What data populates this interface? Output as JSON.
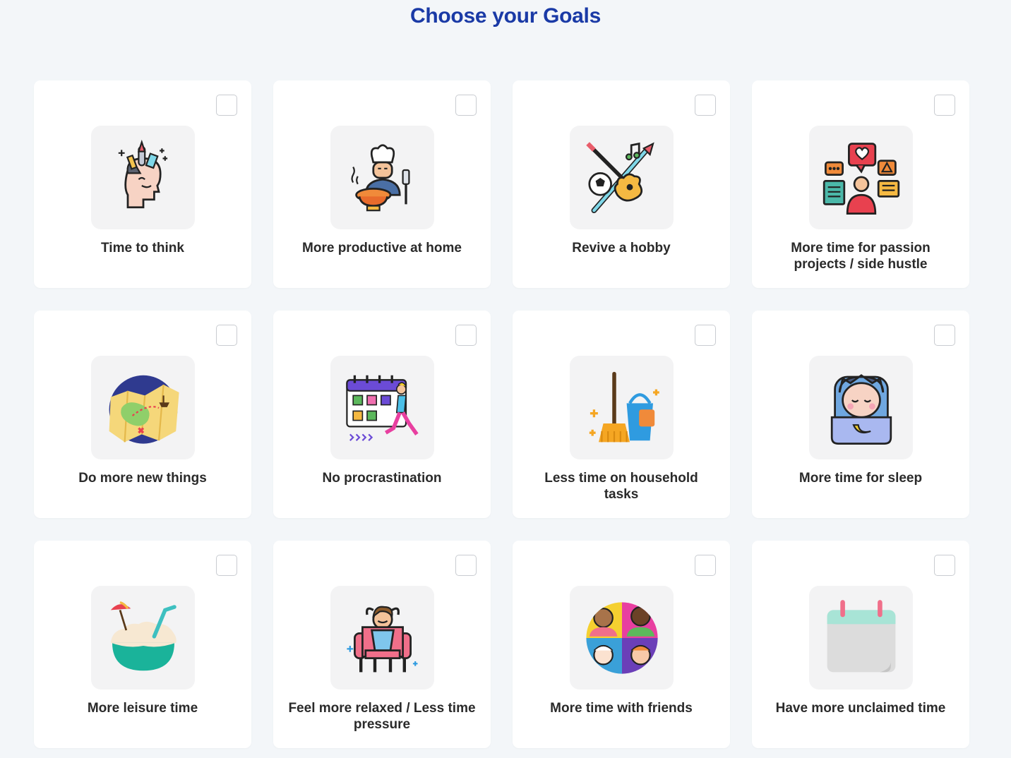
{
  "page_title": "Choose your Goals",
  "goals": [
    {
      "label": "Time to think",
      "icon": "head-ideas-icon",
      "checked": false
    },
    {
      "label": "More productive at home",
      "icon": "chef-cooking-icon",
      "checked": false
    },
    {
      "label": "Revive a hobby",
      "icon": "guitar-hobby-icon",
      "checked": false
    },
    {
      "label": "More time for passion projects / side hustle",
      "icon": "social-bubbles-icon",
      "checked": false
    },
    {
      "label": "Do more new things",
      "icon": "treasure-map-icon",
      "checked": false
    },
    {
      "label": "No procrastination",
      "icon": "calendar-runner-icon",
      "checked": false
    },
    {
      "label": "Less time on household tasks",
      "icon": "broom-bucket-icon",
      "checked": false
    },
    {
      "label": "More time for sleep",
      "icon": "sleeping-baby-icon",
      "checked": false
    },
    {
      "label": "More leisure time",
      "icon": "coconut-drink-icon",
      "checked": false
    },
    {
      "label": "Feel more relaxed / Less time pressure",
      "icon": "relaxed-chair-icon",
      "checked": false
    },
    {
      "label": "More time with friends",
      "icon": "friends-group-icon",
      "checked": false
    },
    {
      "label": "Have more unclaimed time",
      "icon": "blank-calendar-icon",
      "checked": false
    }
  ],
  "colors": {
    "title": "#1a3aa6",
    "background": "#f3f6f9",
    "card": "#ffffff",
    "icon_tile": "#f3f3f4",
    "checkbox_border": "#c9ccd1"
  }
}
